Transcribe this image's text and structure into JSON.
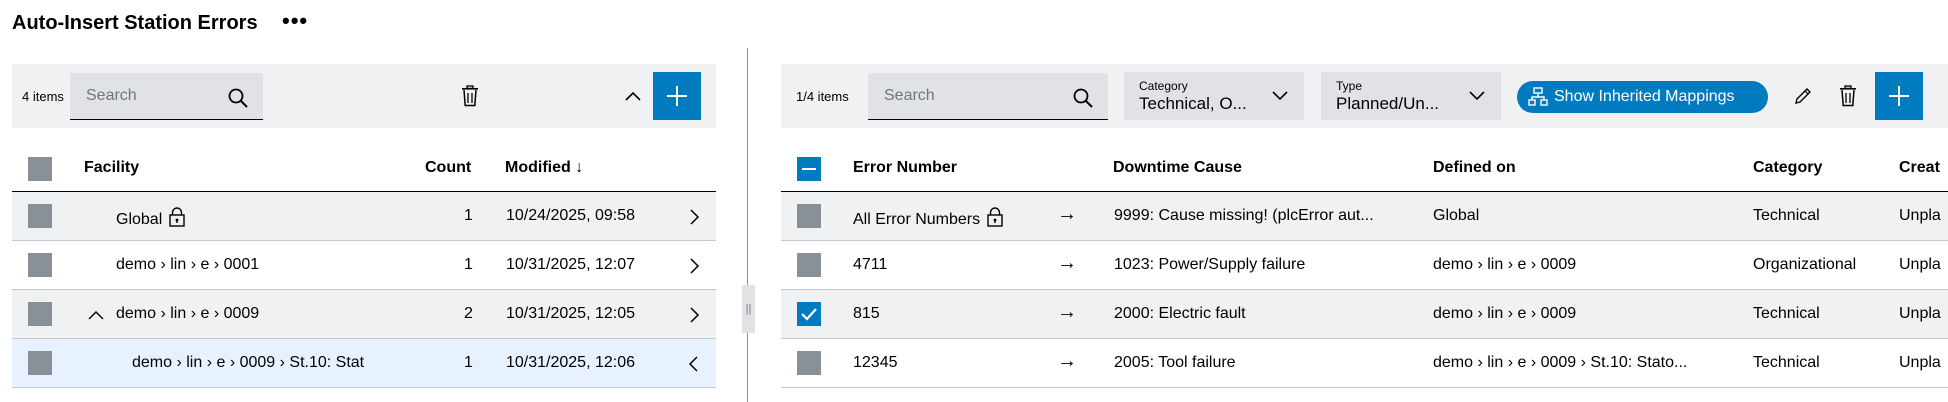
{
  "page": {
    "title": "Auto-Insert Station Errors",
    "more_label": "•••"
  },
  "left": {
    "item_count": "4 items",
    "search_placeholder": "Search",
    "columns": {
      "facility": "Facility",
      "count": "Count",
      "modified": "Modified ↓"
    },
    "rows": [
      {
        "facility": "Global",
        "count": "1",
        "modified": "10/24/2025, 09:58"
      },
      {
        "facility": "demo › lin › e › 0001",
        "count": "1",
        "modified": "10/31/2025, 12:07"
      },
      {
        "facility": "demo › lin › e › 0009",
        "count": "2",
        "modified": "10/31/2025, 12:05"
      },
      {
        "facility": "demo › lin › e › 0009 › St.10: Stat",
        "count": "1",
        "modified": "10/31/2025, 12:06"
      }
    ]
  },
  "right": {
    "item_count": "1/4 items",
    "search_placeholder": "Search",
    "category_filter": {
      "label": "Category",
      "value": "Technical, O..."
    },
    "type_filter": {
      "label": "Type",
      "value": "Planned/Un..."
    },
    "inherited_button": "Show Inherited Mappings",
    "columns": {
      "error_number": "Error Number",
      "downtime_cause": "Downtime Cause",
      "defined_on": "Defined on",
      "category": "Category",
      "created": "Creat"
    },
    "rows": [
      {
        "error_number": "All Error Numbers",
        "arrow": "→",
        "cause": "9999: Cause missing! (plcError aut...",
        "defined_on": "Global",
        "category": "Technical",
        "created": "Unpla"
      },
      {
        "error_number": "4711",
        "arrow": "→",
        "cause": "1023: Power/Supply failure",
        "defined_on": "demo › lin › e › 0009",
        "category": "Organizational",
        "created": "Unpla"
      },
      {
        "error_number": "815",
        "arrow": "→",
        "cause": "2000: Electric fault",
        "defined_on": "demo › lin › e › 0009",
        "category": "Technical",
        "created": "Unpla"
      },
      {
        "error_number": "12345",
        "arrow": "→",
        "cause": "2005: Tool failure",
        "defined_on": "demo › lin › e › 0009 › St.10: Stato...",
        "category": "Technical",
        "created": "Unpla"
      }
    ]
  },
  "colors": {
    "accent": "#007bc0",
    "toolbar_bg": "#eff1f2",
    "selected_row": "#e8f1ff",
    "alt_row": "#eff1f2",
    "checkbox": "#8a9097"
  }
}
